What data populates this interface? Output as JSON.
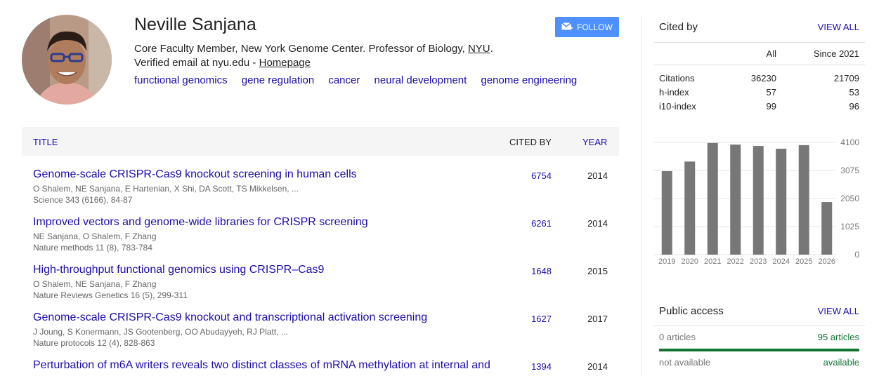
{
  "profile": {
    "name": "Neville Sanjana",
    "affiliation_text": "Core Faculty Member, New York Genome Center. Professor of Biology, ",
    "affiliation_link": "NYU",
    "affiliation_end": ".",
    "verified_text": "Verified email at nyu.edu - ",
    "homepage_link": "Homepage",
    "interests": [
      "functional genomics",
      "gene regulation",
      "cancer",
      "neural development",
      "genome engineering"
    ],
    "follow_label": "FOLLOW"
  },
  "table": {
    "header": {
      "title": "TITLE",
      "cited_by": "CITED BY",
      "year": "YEAR"
    },
    "rows": [
      {
        "title": "Genome-scale CRISPR-Cas9 knockout screening in human cells",
        "authors": "O Shalem, NE Sanjana, E Hartenian, X Shi, DA Scott, TS Mikkelsen, ...",
        "venue": "Science 343 (6166), 84-87",
        "cited": "6754",
        "year": "2014"
      },
      {
        "title": "Improved vectors and genome-wide libraries for CRISPR screening",
        "authors": "NE Sanjana, O Shalem, F Zhang",
        "venue": "Nature methods 11 (8), 783-784",
        "cited": "6261",
        "year": "2014"
      },
      {
        "title": "High-throughput functional genomics using CRISPR–Cas9",
        "authors": "O Shalem, NE Sanjana, F Zhang",
        "venue": "Nature Reviews Genetics 16 (5), 299-311",
        "cited": "1648",
        "year": "2015"
      },
      {
        "title": "Genome-scale CRISPR-Cas9 knockout and transcriptional activation screening",
        "authors": "J Joung, S Konermann, JS Gootenberg, OO Abudayyeh, RJ Platt, ...",
        "venue": "Nature protocols 12 (4), 828-863",
        "cited": "1627",
        "year": "2017"
      },
      {
        "title": "Perturbation of m6A writers reveals two distinct classes of mRNA methylation at internal and",
        "authors": "",
        "venue": "",
        "cited": "1394",
        "year": "2014"
      }
    ]
  },
  "cited_by": {
    "title": "Cited by",
    "view_all": "VIEW ALL",
    "col_all": "All",
    "col_since": "Since 2021",
    "stats": [
      {
        "label": "Citations",
        "all": "36230",
        "since": "21709"
      },
      {
        "label": "h-index",
        "all": "57",
        "since": "53"
      },
      {
        "label": "i10-index",
        "all": "99",
        "since": "96"
      }
    ]
  },
  "chart_data": {
    "type": "bar",
    "categories": [
      "2019",
      "2020",
      "2021",
      "2022",
      "2023",
      "2024",
      "2025",
      "2026"
    ],
    "values": [
      3050,
      3400,
      4080,
      4020,
      3970,
      3870,
      4000,
      1920
    ],
    "yticks": [
      "4100",
      "3075",
      "2050",
      "1025",
      "0"
    ],
    "ylim": [
      0,
      4100
    ],
    "bar_color": "#777777",
    "grid": true
  },
  "public_access": {
    "title": "Public access",
    "view_all": "VIEW ALL",
    "left_count": "0 articles",
    "right_count": "95 articles",
    "left_status": "not available",
    "right_status": "available",
    "progress_available_fraction": 1.0,
    "bar_color": "#137333"
  }
}
